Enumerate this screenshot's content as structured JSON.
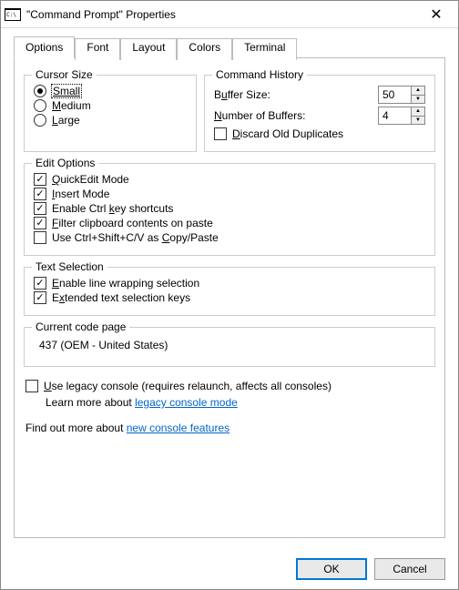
{
  "window": {
    "title": "\"Command Prompt\" Properties"
  },
  "tabs": {
    "options": "Options",
    "font": "Font",
    "layout": "Layout",
    "colors": "Colors",
    "terminal": "Terminal"
  },
  "cursor": {
    "legend": "Cursor Size",
    "small": "Small",
    "medium": "Medium",
    "large": "Large",
    "selected": "small"
  },
  "history": {
    "legend": "Command History",
    "buffer_label_pre": "B",
    "buffer_label_mid": "u",
    "buffer_label_post": "ffer Size:",
    "buffer_value": "50",
    "num_label_pre": "",
    "num_label_u": "N",
    "num_label_post": "umber of Buffers:",
    "num_value": "4",
    "discard_pre": "",
    "discard_u": "D",
    "discard_post": "iscard Old Duplicates",
    "discard_checked": false
  },
  "edit": {
    "legend": "Edit Options",
    "quickedit": {
      "pre": "",
      "u": "Q",
      "post": "uickEdit Mode",
      "checked": true
    },
    "insert": {
      "pre": "",
      "u": "I",
      "post": "nsert Mode",
      "checked": true
    },
    "ctrlkey": {
      "pre": "Enable Ctrl ",
      "u": "k",
      "post": "ey shortcuts",
      "checked": true
    },
    "filter": {
      "pre": "",
      "u": "F",
      "post": "ilter clipboard contents on paste",
      "checked": true
    },
    "ctrlshift": {
      "pre": "Use Ctrl+Shift+C/V as ",
      "u": "C",
      "post": "opy/Paste",
      "checked": false
    }
  },
  "textsel": {
    "legend": "Text Selection",
    "linewrap": {
      "pre": "",
      "u": "E",
      "post": "nable line wrapping selection",
      "checked": true
    },
    "extended": {
      "pre": "E",
      "u": "x",
      "post": "tended text selection keys",
      "checked": true
    }
  },
  "codepage": {
    "legend": "Current code page",
    "value": "437  (OEM - United States)"
  },
  "legacy": {
    "checkbox": {
      "pre": "",
      "u": "U",
      "post": "se legacy console (requires relaunch, affects all consoles)",
      "checked": false
    },
    "learn_pre": "Learn more about ",
    "learn_link": "legacy console mode"
  },
  "findout": {
    "pre": "Find out more about ",
    "link": "new console features"
  },
  "buttons": {
    "ok": "OK",
    "cancel": "Cancel"
  }
}
